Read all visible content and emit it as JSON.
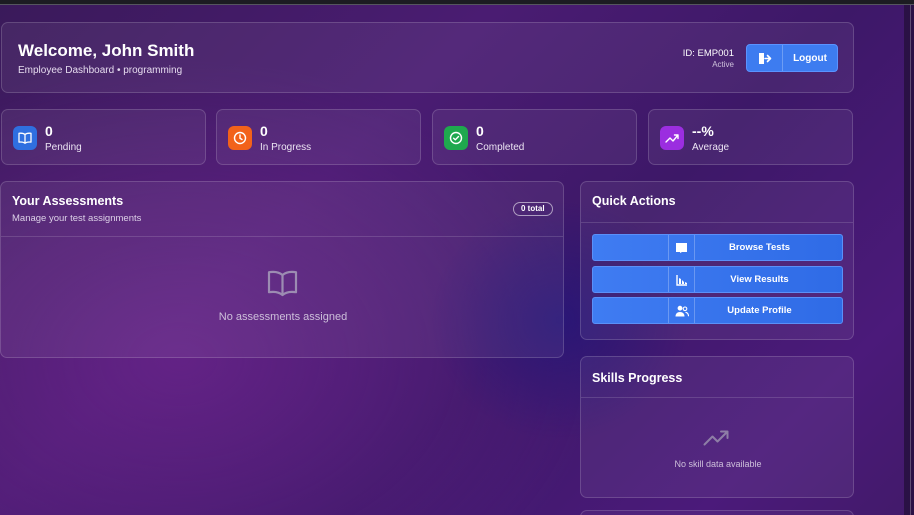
{
  "header": {
    "welcome": "Welcome, John Smith",
    "subtitle": "Employee Dashboard • programming",
    "employee_id": "ID: EMP001",
    "status": "Active",
    "logout_label": "Logout"
  },
  "stats": [
    {
      "value": "0",
      "label": "Pending",
      "icon": "book-icon",
      "color": "#2f6fe0"
    },
    {
      "value": "0",
      "label": "In Progress",
      "icon": "clock-icon",
      "color": "#f2621a"
    },
    {
      "value": "0",
      "label": "Completed",
      "icon": "check-circle-icon",
      "color": "#1fa84e"
    },
    {
      "value": "--%",
      "label": "Average",
      "icon": "trending-up-icon",
      "color": "#9b2ee0"
    }
  ],
  "assessments": {
    "title": "Your Assessments",
    "subtitle": "Manage your test assignments",
    "total_badge": "0 total",
    "empty_text": "No assessments assigned"
  },
  "quick_actions": {
    "title": "Quick Actions",
    "buttons": [
      {
        "label": "Browse Tests",
        "icon": "book-icon"
      },
      {
        "label": "View Results",
        "icon": "chart-icon"
      },
      {
        "label": "Update Profile",
        "icon": "users-icon"
      }
    ]
  },
  "skills": {
    "title": "Skills Progress",
    "empty_text": "No skill data available"
  }
}
